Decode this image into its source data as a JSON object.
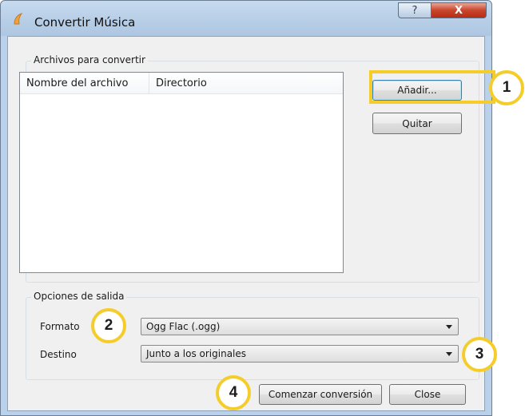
{
  "window": {
    "title": "Convertir Música",
    "help_label": "?",
    "close_label": "X"
  },
  "files_group": {
    "label": "Archivos para convertir",
    "columns": [
      "Nombre del archivo",
      "Directorio"
    ],
    "add_label": "Añadir...",
    "remove_label": "Quitar"
  },
  "output_group": {
    "label": "Opciones de salida",
    "format_label": "Formato",
    "format_value": "Ogg Flac (.ogg)",
    "destination_label": "Destino",
    "destination_value": "Junto a los originales"
  },
  "actions": {
    "start_label": "Comenzar conversión",
    "close_label": "Close"
  },
  "callouts": [
    "1",
    "2",
    "3",
    "4"
  ],
  "colors": {
    "callout": "#f5cd2b",
    "titlebar": "#b9d1ea",
    "close_button": "#c9452b"
  }
}
